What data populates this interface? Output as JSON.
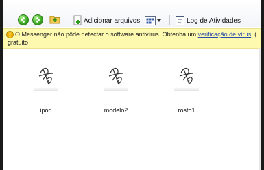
{
  "toolbar": {
    "add_files_label": "Adicionar arquivos",
    "activity_log_label": "Log de Atividades"
  },
  "warning": {
    "text_before_link": "O Messenger não pôde detectar o software antivírus. Obtenha um ",
    "link_text": "verificação de vírus",
    "text_after_link": ". (",
    "line2": "gratuito"
  },
  "files": [
    {
      "name": "ipod",
      "icon": "signature-thumbnail-icon"
    },
    {
      "name": "modelo2",
      "icon": "signature-thumbnail-icon"
    },
    {
      "name": "rosto1",
      "icon": "signature-thumbnail-icon"
    }
  ],
  "colors": {
    "warning_bg": "#fdfab0",
    "nav_green": "#3fae24",
    "link": "#2a4fa8"
  }
}
